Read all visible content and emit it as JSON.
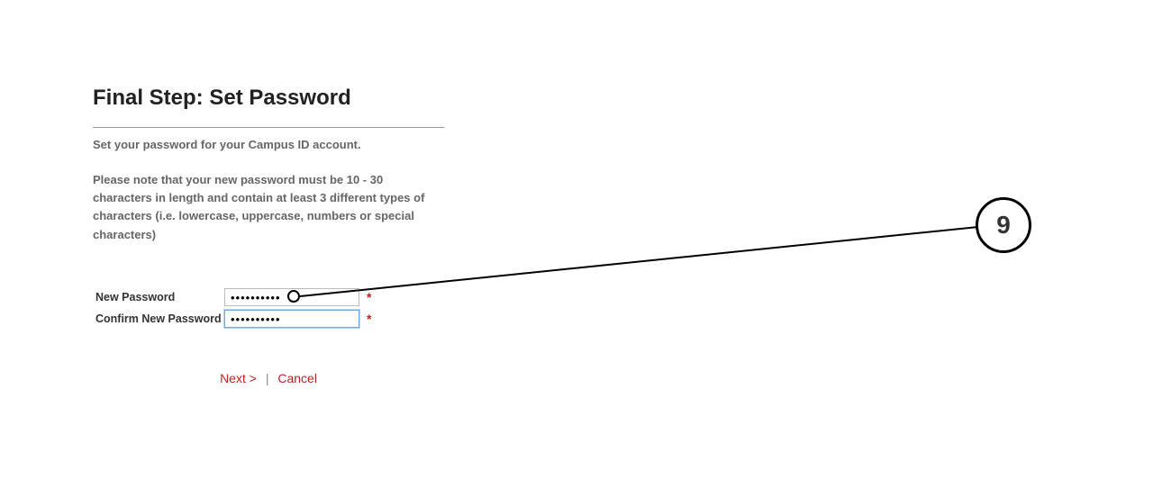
{
  "title": "Final Step: Set Password",
  "intro": "Set your password for your Campus ID account.",
  "note": "Please note that your new password must be 10 - 30 characters in length and contain at least 3 different types of characters (i.e. lowercase, uppercase, numbers or special characters)",
  "form": {
    "new_password_label": "New Password",
    "new_password_value": "••••••••••",
    "confirm_label": "Confirm New Password",
    "confirm_value": "••••••••••",
    "required_mark": "*"
  },
  "actions": {
    "next_label": "Next >",
    "separator": "|",
    "cancel_label": "Cancel"
  },
  "annotation": {
    "badge_number": "9"
  }
}
